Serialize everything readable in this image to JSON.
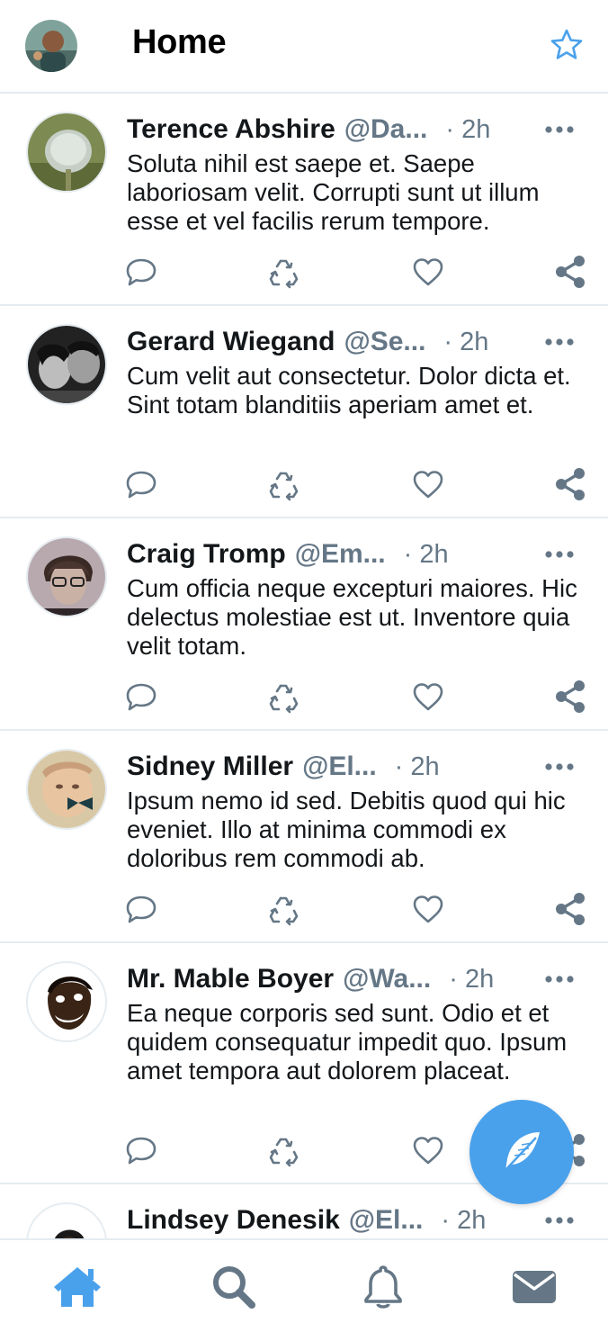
{
  "header": {
    "title": "Home",
    "avatar_icon": "user-avatar",
    "star_icon": "star-icon"
  },
  "colors": {
    "accent": "#4aa1eb",
    "muted": "#657786",
    "divider": "#e6ecf0",
    "text": "#14171a"
  },
  "tweets": [
    {
      "name": "Terence Abshire",
      "handle": "@Da...",
      "time": "· 2h",
      "body": "Soluta nihil est saepe et. Saepe laboriosam velit. Corrupti sunt ut illum esse et vel facilis rerum tempore."
    },
    {
      "name": "Gerard Wiegand",
      "handle": "@Se...",
      "time": "· 2h",
      "body": "Cum velit aut consectetur. Dolor dicta et. Sint totam blanditiis aperiam amet et."
    },
    {
      "name": "Craig Tromp",
      "handle": "@Em...",
      "time": "· 2h",
      "body": "Cum officia neque excepturi maiores. Hic delectus molestiae est ut. Inventore quia velit totam."
    },
    {
      "name": "Sidney Miller",
      "handle": "@El...",
      "time": "· 2h",
      "body": "Ipsum nemo id sed. Debitis quod qui hic eveniet. Illo at minima commodi ex doloribus rem commodi ab."
    },
    {
      "name": "Mr. Mable Boyer",
      "handle": "@Wa...",
      "time": "· 2h",
      "body": "Ea neque corporis sed sunt. Odio et et quidem consequatur impedit quo. Ipsum amet tempora aut dolorem placeat."
    },
    {
      "name": "Lindsey Denesik",
      "handle": "@El...",
      "time": "· 2h",
      "body": ""
    }
  ],
  "actions": [
    "reply-icon",
    "retweet-icon",
    "like-icon",
    "share-icon"
  ],
  "fab": {
    "icon": "feather-compose-icon"
  },
  "bottom_nav": [
    {
      "icon": "home-icon",
      "active": true
    },
    {
      "icon": "search-icon",
      "active": false
    },
    {
      "icon": "bell-icon",
      "active": false
    },
    {
      "icon": "mail-icon",
      "active": false
    }
  ]
}
